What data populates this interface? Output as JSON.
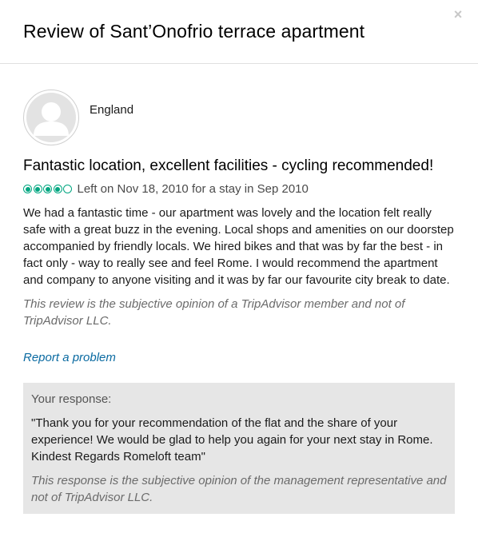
{
  "dialog": {
    "title": "Review of Sant’Onofrio terrace apartment",
    "close_icon": "×"
  },
  "reviewer": {
    "location": "England",
    "avatar_icon": "default-user-avatar"
  },
  "review": {
    "title": "Fantastic location, excellent facilities - cycling recommended!",
    "rating": 4,
    "rating_max": 5,
    "rating_color": "#00a680",
    "meta": "Left on Nov 18, 2010 for a stay in Sep 2010",
    "text": "We had a fantastic time - our apartment was lovely and the location felt really safe with a great buzz in the evening. Local shops and amenities on our doorstep accompanied by friendly locals. We hired bikes and that was by far the best - in fact only - way to really see and feel Rome. I would recommend the apartment and company to anyone visiting and it was by far our favourite city break to date.",
    "disclaimer": "This review is the subjective opinion of a TripAdvisor member and not of TripAdvisor LLC.",
    "report_link": "Report a problem"
  },
  "response": {
    "label": "Your response:",
    "text": "\"Thank you for your recommendation of the flat and the share of your experience! We would be glad to help you again for your next stay in Rome. Kindest Regards Romeloft team\"",
    "disclaimer": "This response is the subjective opinion of the management representative and not of TripAdvisor LLC."
  },
  "colors": {
    "link": "#0a6aa1",
    "response_bg": "#e6e6e6"
  }
}
